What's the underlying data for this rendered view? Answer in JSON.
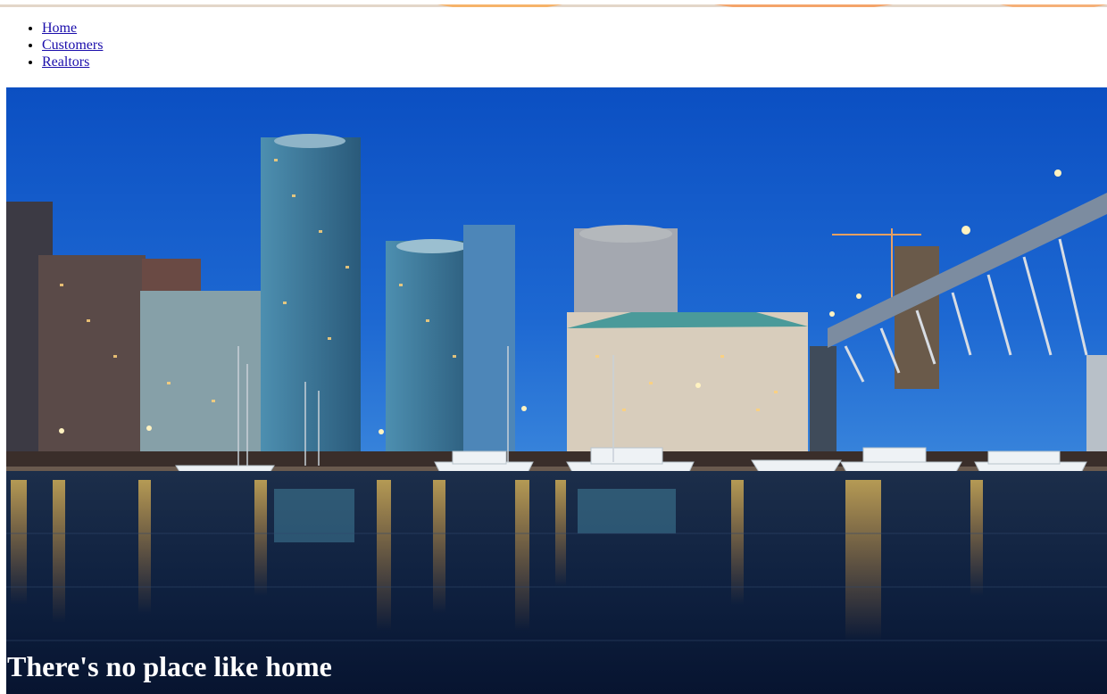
{
  "nav": {
    "items": [
      {
        "label": "Home"
      },
      {
        "label": "Customers"
      },
      {
        "label": "Realtors"
      }
    ]
  },
  "hero": {
    "image_subject": "city skyline at dusk over marina",
    "tagline": "There's no place like home"
  },
  "colors": {
    "link": "#1a0dab",
    "sky_top": "#0b4fc2",
    "sky_bottom": "#2a78d8",
    "water": "#081a35",
    "tagline": "#ffffff"
  }
}
